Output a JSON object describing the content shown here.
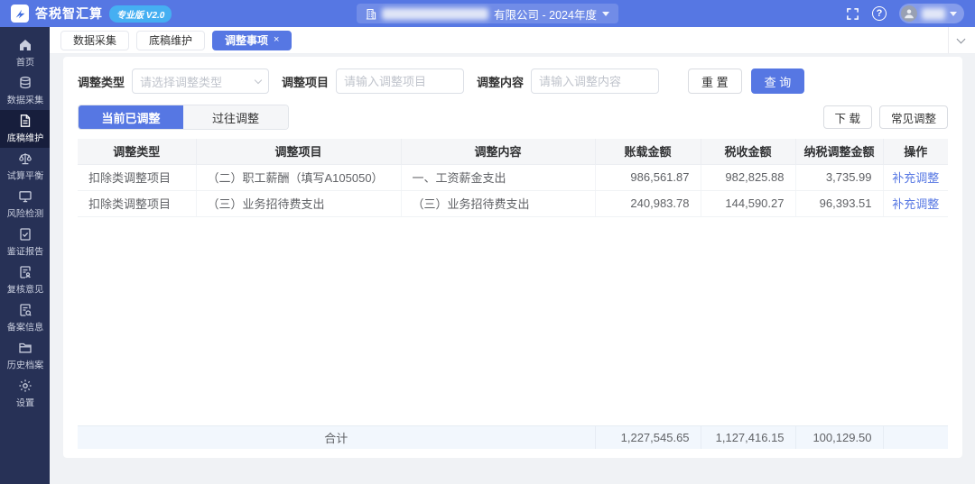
{
  "colors": {
    "accent": "#5677e3",
    "topbar": "#5677e3",
    "badge": "#45aff2",
    "sidebar_bg": "#273156",
    "sidebar_active_bg": "#171e3c",
    "link": "#5677e3",
    "summary_bg": "#f2f7fd"
  },
  "icons": {
    "close": "×",
    "help": "?"
  },
  "topbar": {
    "brand": "答税智汇算",
    "badge": "专业版 V2.0",
    "company_suffix": "有限公司 - 2024年度"
  },
  "sidebar": {
    "items": [
      {
        "label": "首页",
        "icon": "home-icon"
      },
      {
        "label": "数据采集",
        "icon": "database-icon"
      },
      {
        "label": "底稿维护",
        "icon": "document-icon"
      },
      {
        "label": "试算平衡",
        "icon": "scale-icon"
      },
      {
        "label": "风险检测",
        "icon": "monitor-icon"
      },
      {
        "label": "鉴证报告",
        "icon": "report-check-icon"
      },
      {
        "label": "复核意见",
        "icon": "review-doc-icon"
      },
      {
        "label": "备案信息",
        "icon": "record-doc-icon"
      },
      {
        "label": "历史档案",
        "icon": "folder-icon"
      },
      {
        "label": "设置",
        "icon": "gear-icon"
      }
    ],
    "active": "底稿维护"
  },
  "tabs": [
    {
      "label": "数据采集"
    },
    {
      "label": "底稿维护"
    },
    {
      "label": "调整事项",
      "active": true
    }
  ],
  "filters": {
    "type_label": "调整类型",
    "type_placeholder": "请选择调整类型",
    "item_label": "调整项目",
    "item_placeholder": "请输入调整项目",
    "content_label": "调整内容",
    "content_placeholder": "请输入调整内容",
    "reset": "重 置",
    "query": "查 询"
  },
  "subtabs": {
    "current": "当前已调整",
    "past": "过往调整"
  },
  "actions": {
    "download": "下 载",
    "common": "常见调整"
  },
  "table": {
    "columns": [
      "调整类型",
      "调整项目",
      "调整内容",
      "账载金额",
      "税收金额",
      "纳税调整金额",
      "操作"
    ],
    "rows": [
      {
        "type": "扣除类调整项目",
        "item": "（二）职工薪酬（填写A105050）",
        "content": "一、工资薪金支出",
        "book_amount": "986,561.87",
        "tax_amount": "982,825.88",
        "adjust_amount": "3,735.99",
        "action": "补充调整"
      },
      {
        "type": "扣除类调整项目",
        "item": "（三）业务招待费支出",
        "content": "（三）业务招待费支出",
        "book_amount": "240,983.78",
        "tax_amount": "144,590.27",
        "adjust_amount": "96,393.51",
        "action": "补充调整"
      }
    ],
    "summary": {
      "label": "合计",
      "book_amount": "1,227,545.65",
      "tax_amount": "1,127,416.15",
      "adjust_amount": "100,129.50"
    }
  }
}
